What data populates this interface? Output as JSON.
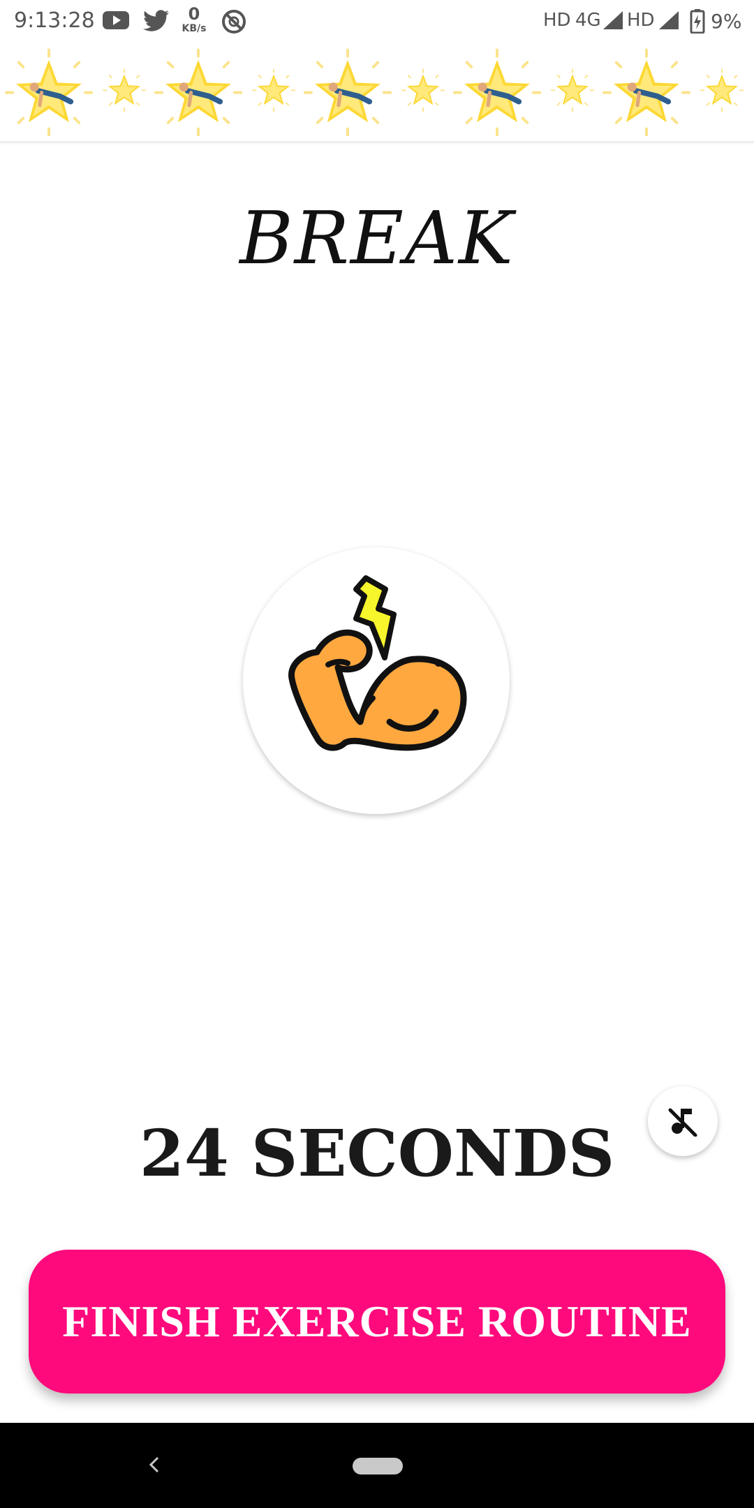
{
  "status_bar": {
    "time": "9:13:28",
    "data_rate_value": "0",
    "data_rate_unit": "KB/s",
    "network_label_1": "HD",
    "network_type": "4G",
    "network_label_2": "HD",
    "battery_percent": "9%"
  },
  "icons": {
    "youtube": "youtube-icon",
    "twitter": "twitter-icon",
    "sync": "sync-off-icon",
    "signal": "signal-icon",
    "battery": "battery-charging-icon",
    "emblem": "flexed-arm-icon",
    "mute": "music-off-icon",
    "back": "back-chevron-icon",
    "home": "home-pill-icon"
  },
  "exercise_strip": {
    "items": [
      "pushup",
      "small-star",
      "situp",
      "small-star",
      "plank",
      "small-star",
      "machine",
      "small-star",
      "leg-raise",
      "small-star"
    ]
  },
  "screen": {
    "title": "BREAK",
    "countdown_value": "24",
    "countdown_unit": "SECONDS"
  },
  "finish_button": {
    "label": "FINISH EXERCISE ROUTINE"
  },
  "colors": {
    "accent": "#ff0a7c",
    "star": "#fdd835",
    "arm": "#ffa840",
    "bolt": "#f7f52c"
  }
}
